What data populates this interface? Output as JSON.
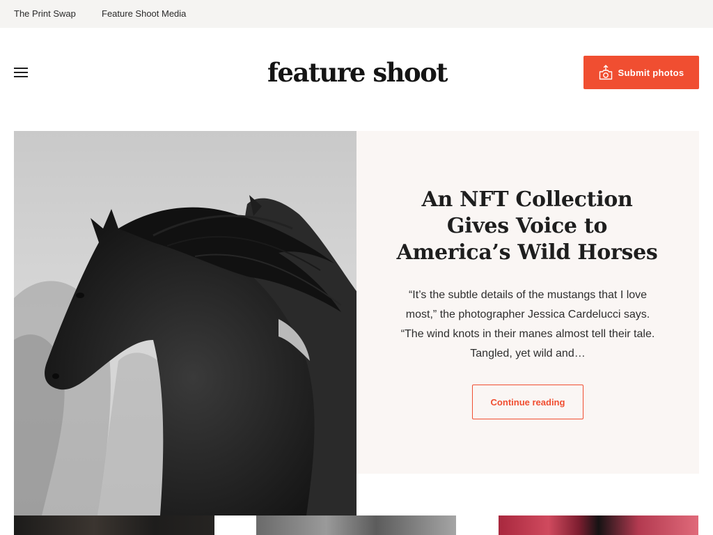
{
  "topbar": {
    "links": [
      "The Print Swap",
      "Feature Shoot Media"
    ]
  },
  "header": {
    "logo_text": "feature shoot",
    "submit_label": "Submit photos",
    "menu_icon": "hamburger-menu-icon",
    "submit_icon": "camera-upload-icon"
  },
  "hero": {
    "image_alt": "Black and white photo of wild horses with flowing manes",
    "title": "An NFT Collection Gives Voice to America’s Wild Horses",
    "excerpt": "“It’s the subtle details of the mustangs that I love most,” the photographer Jessica Cardelucci says. “The wind knots in their manes almost tell their tale. Tangled, yet wild and…",
    "cta_label": "Continue reading"
  },
  "colors": {
    "accent": "#f04e31",
    "topbar_bg": "#f5f4f2",
    "panel_bg": "#faf6f4",
    "text": "#1e1e1e"
  }
}
